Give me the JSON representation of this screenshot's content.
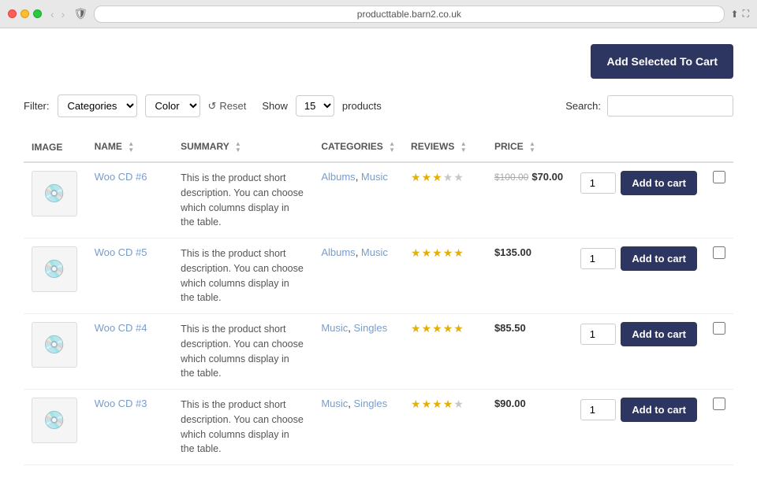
{
  "browser": {
    "url": "producttable.barn2.co.uk",
    "tab_icon": "🛡️"
  },
  "toolbar": {
    "add_selected_label": "Add Selected To Cart"
  },
  "filters": {
    "filter_label": "Filter:",
    "categories_placeholder": "Categories",
    "color_placeholder": "Color",
    "reset_label": "Reset",
    "show_label": "Show",
    "count": "15",
    "products_label": "products",
    "search_label": "Search:"
  },
  "table": {
    "columns": [
      {
        "id": "image",
        "label": "IMAGE",
        "sortable": false
      },
      {
        "id": "name",
        "label": "NAME",
        "sortable": true
      },
      {
        "id": "summary",
        "label": "SUMMARY",
        "sortable": true
      },
      {
        "id": "categories",
        "label": "CATEGORIES",
        "sortable": true
      },
      {
        "id": "reviews",
        "label": "REVIEWS",
        "sortable": true
      },
      {
        "id": "price",
        "label": "PRICE",
        "sortable": true
      }
    ],
    "rows": [
      {
        "id": 1,
        "image_emoji": "💿",
        "name": "Woo CD #6",
        "summary": "This is the product short description. You can choose which columns display in the table.",
        "categories": [
          "Albums",
          "Music"
        ],
        "reviews_filled": 3,
        "reviews_total": 5,
        "original_price": "$100.00",
        "sale_price": "$70.00",
        "regular_price": null,
        "qty": 1,
        "add_to_cart_label": "Add to cart"
      },
      {
        "id": 2,
        "image_emoji": "💿",
        "name": "Woo CD #5",
        "summary": "This is the product short description. You can choose which columns display in the table.",
        "categories": [
          "Albums",
          "Music"
        ],
        "reviews_filled": 5,
        "reviews_total": 5,
        "original_price": null,
        "sale_price": null,
        "regular_price": "$135.00",
        "qty": 1,
        "add_to_cart_label": "Add to cart"
      },
      {
        "id": 3,
        "image_emoji": "💿",
        "name": "Woo CD #4",
        "summary": "This is the product short description. You can choose which columns display in the table.",
        "categories": [
          "Music",
          "Singles"
        ],
        "reviews_filled": 5,
        "reviews_total": 5,
        "original_price": null,
        "sale_price": null,
        "regular_price": "$85.50",
        "qty": 1,
        "add_to_cart_label": "Add to cart"
      },
      {
        "id": 4,
        "image_emoji": "💿",
        "name": "Woo CD #3",
        "summary": "This is the product short description. You can choose which columns display in the table.",
        "categories": [
          "Music",
          "Singles"
        ],
        "reviews_filled": 4,
        "reviews_total": 5,
        "original_price": null,
        "sale_price": null,
        "regular_price": "$90.00",
        "qty": 1,
        "add_to_cart_label": "Add to cart"
      }
    ]
  }
}
